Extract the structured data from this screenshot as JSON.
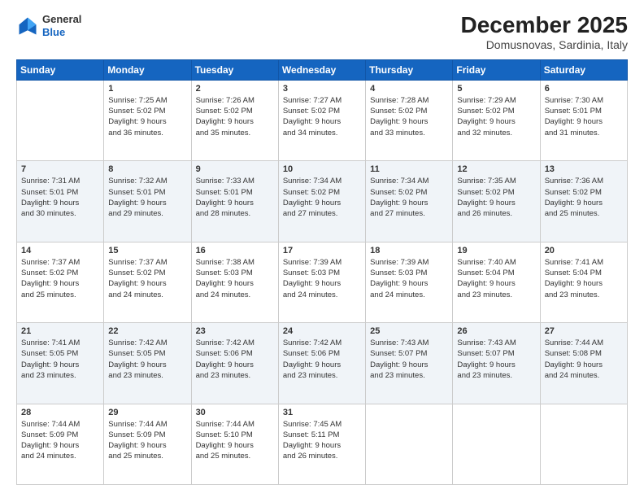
{
  "header": {
    "logo_line1": "General",
    "logo_line2": "Blue",
    "month": "December 2025",
    "location": "Domusnovas, Sardinia, Italy"
  },
  "days_of_week": [
    "Sunday",
    "Monday",
    "Tuesday",
    "Wednesday",
    "Thursday",
    "Friday",
    "Saturday"
  ],
  "weeks": [
    [
      {
        "day": "",
        "info": ""
      },
      {
        "day": "1",
        "info": "Sunrise: 7:25 AM\nSunset: 5:02 PM\nDaylight: 9 hours\nand 36 minutes."
      },
      {
        "day": "2",
        "info": "Sunrise: 7:26 AM\nSunset: 5:02 PM\nDaylight: 9 hours\nand 35 minutes."
      },
      {
        "day": "3",
        "info": "Sunrise: 7:27 AM\nSunset: 5:02 PM\nDaylight: 9 hours\nand 34 minutes."
      },
      {
        "day": "4",
        "info": "Sunrise: 7:28 AM\nSunset: 5:02 PM\nDaylight: 9 hours\nand 33 minutes."
      },
      {
        "day": "5",
        "info": "Sunrise: 7:29 AM\nSunset: 5:02 PM\nDaylight: 9 hours\nand 32 minutes."
      },
      {
        "day": "6",
        "info": "Sunrise: 7:30 AM\nSunset: 5:01 PM\nDaylight: 9 hours\nand 31 minutes."
      }
    ],
    [
      {
        "day": "7",
        "info": "Sunrise: 7:31 AM\nSunset: 5:01 PM\nDaylight: 9 hours\nand 30 minutes."
      },
      {
        "day": "8",
        "info": "Sunrise: 7:32 AM\nSunset: 5:01 PM\nDaylight: 9 hours\nand 29 minutes."
      },
      {
        "day": "9",
        "info": "Sunrise: 7:33 AM\nSunset: 5:01 PM\nDaylight: 9 hours\nand 28 minutes."
      },
      {
        "day": "10",
        "info": "Sunrise: 7:34 AM\nSunset: 5:02 PM\nDaylight: 9 hours\nand 27 minutes."
      },
      {
        "day": "11",
        "info": "Sunrise: 7:34 AM\nSunset: 5:02 PM\nDaylight: 9 hours\nand 27 minutes."
      },
      {
        "day": "12",
        "info": "Sunrise: 7:35 AM\nSunset: 5:02 PM\nDaylight: 9 hours\nand 26 minutes."
      },
      {
        "day": "13",
        "info": "Sunrise: 7:36 AM\nSunset: 5:02 PM\nDaylight: 9 hours\nand 25 minutes."
      }
    ],
    [
      {
        "day": "14",
        "info": "Sunrise: 7:37 AM\nSunset: 5:02 PM\nDaylight: 9 hours\nand 25 minutes."
      },
      {
        "day": "15",
        "info": "Sunrise: 7:37 AM\nSunset: 5:02 PM\nDaylight: 9 hours\nand 24 minutes."
      },
      {
        "day": "16",
        "info": "Sunrise: 7:38 AM\nSunset: 5:03 PM\nDaylight: 9 hours\nand 24 minutes."
      },
      {
        "day": "17",
        "info": "Sunrise: 7:39 AM\nSunset: 5:03 PM\nDaylight: 9 hours\nand 24 minutes."
      },
      {
        "day": "18",
        "info": "Sunrise: 7:39 AM\nSunset: 5:03 PM\nDaylight: 9 hours\nand 24 minutes."
      },
      {
        "day": "19",
        "info": "Sunrise: 7:40 AM\nSunset: 5:04 PM\nDaylight: 9 hours\nand 23 minutes."
      },
      {
        "day": "20",
        "info": "Sunrise: 7:41 AM\nSunset: 5:04 PM\nDaylight: 9 hours\nand 23 minutes."
      }
    ],
    [
      {
        "day": "21",
        "info": "Sunrise: 7:41 AM\nSunset: 5:05 PM\nDaylight: 9 hours\nand 23 minutes."
      },
      {
        "day": "22",
        "info": "Sunrise: 7:42 AM\nSunset: 5:05 PM\nDaylight: 9 hours\nand 23 minutes."
      },
      {
        "day": "23",
        "info": "Sunrise: 7:42 AM\nSunset: 5:06 PM\nDaylight: 9 hours\nand 23 minutes."
      },
      {
        "day": "24",
        "info": "Sunrise: 7:42 AM\nSunset: 5:06 PM\nDaylight: 9 hours\nand 23 minutes."
      },
      {
        "day": "25",
        "info": "Sunrise: 7:43 AM\nSunset: 5:07 PM\nDaylight: 9 hours\nand 23 minutes."
      },
      {
        "day": "26",
        "info": "Sunrise: 7:43 AM\nSunset: 5:07 PM\nDaylight: 9 hours\nand 23 minutes."
      },
      {
        "day": "27",
        "info": "Sunrise: 7:44 AM\nSunset: 5:08 PM\nDaylight: 9 hours\nand 24 minutes."
      }
    ],
    [
      {
        "day": "28",
        "info": "Sunrise: 7:44 AM\nSunset: 5:09 PM\nDaylight: 9 hours\nand 24 minutes."
      },
      {
        "day": "29",
        "info": "Sunrise: 7:44 AM\nSunset: 5:09 PM\nDaylight: 9 hours\nand 25 minutes."
      },
      {
        "day": "30",
        "info": "Sunrise: 7:44 AM\nSunset: 5:10 PM\nDaylight: 9 hours\nand 25 minutes."
      },
      {
        "day": "31",
        "info": "Sunrise: 7:45 AM\nSunset: 5:11 PM\nDaylight: 9 hours\nand 26 minutes."
      },
      {
        "day": "",
        "info": ""
      },
      {
        "day": "",
        "info": ""
      },
      {
        "day": "",
        "info": ""
      }
    ]
  ]
}
